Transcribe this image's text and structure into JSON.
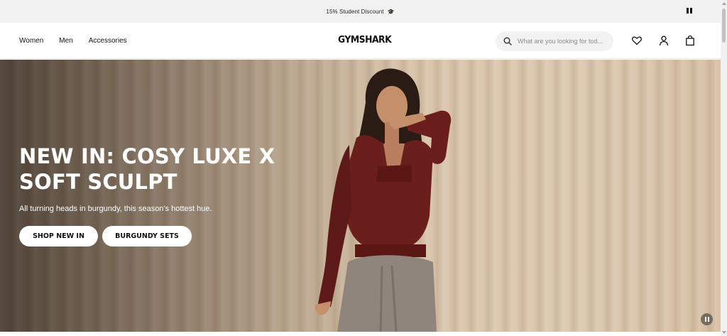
{
  "announcement": {
    "text": "15% Student Discount",
    "icon": "graduation-cap-icon"
  },
  "nav": {
    "links": [
      "Women",
      "Men",
      "Accessories"
    ],
    "logo": "GYMSHARK",
    "search_placeholder": "What are you looking for tod..."
  },
  "hero": {
    "headline": "NEW IN: COSY LUXE X SOFT SCULPT",
    "subtext": "All turning heads in burgundy, this season's hottest hue.",
    "primary_button": "SHOP NEW IN",
    "secondary_button": "BURGUNDY SETS"
  },
  "colors": {
    "accent": "#111111",
    "announcement_bg": "#f2f2f2",
    "top_color": "#6b1f1c",
    "curtain": "#d9c4aa"
  }
}
